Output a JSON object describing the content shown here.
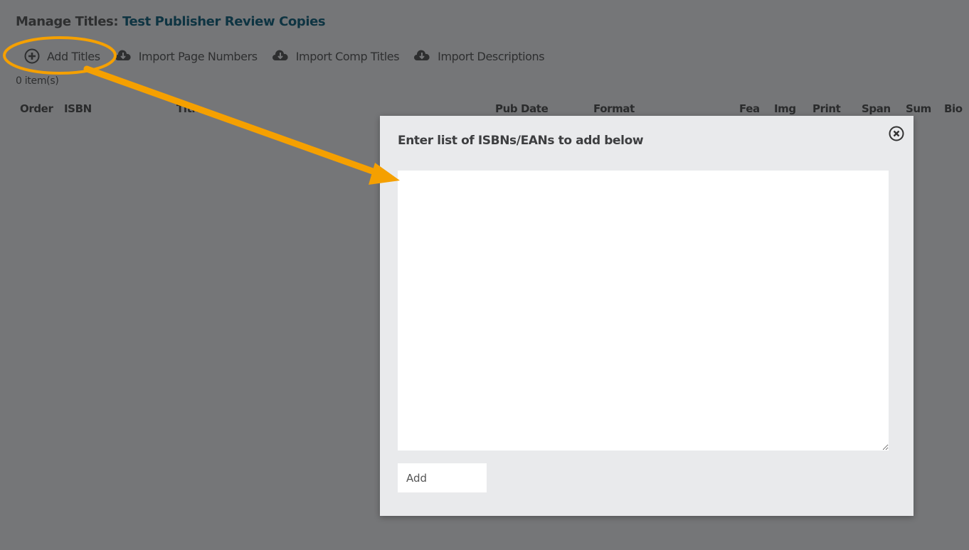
{
  "header": {
    "label": "Manage Titles:",
    "publisher": "Test Publisher Review Copies"
  },
  "toolbar": {
    "items": [
      {
        "label": "Add Titles",
        "icon": "plus-circle-icon"
      },
      {
        "label": "Import Page Numbers",
        "icon": "cloud-download-icon"
      },
      {
        "label": "Import Comp Titles",
        "icon": "cloud-download-icon"
      },
      {
        "label": "Import Descriptions",
        "icon": "cloud-download-icon"
      }
    ]
  },
  "item_count": "0 item(s)",
  "table": {
    "columns": [
      "Order",
      "ISBN",
      "Title",
      "Pub Date",
      "Format",
      "Fea",
      "Img",
      "Print",
      "Span",
      "Sum",
      "Bio"
    ]
  },
  "modal": {
    "title": "Enter list of ISBNs/EANs to add below",
    "textarea_value": "",
    "add_label": "Add"
  },
  "annotation": {
    "color": "#f5a000"
  }
}
